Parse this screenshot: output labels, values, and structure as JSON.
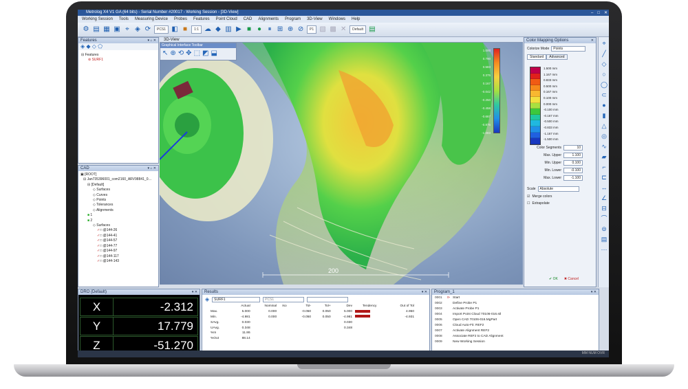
{
  "window": {
    "title": "Metrolog X4 V1 GA (64 bits) - Serial Number #20017 - Working Session - [3D-View]"
  },
  "menu": [
    "Working Session",
    "Tools",
    "Measuring Device",
    "Probes",
    "Features",
    "Point Cloud",
    "CAD",
    "Alignments",
    "Program",
    "3D-View",
    "Windows",
    "Help"
  ],
  "toolbar": {
    "frame": "PCS1",
    "zoom": "1:1",
    "probe": "P1",
    "view": "Default"
  },
  "features_panel": {
    "title": "Features",
    "items": [
      "Features",
      "SURF1"
    ]
  },
  "cad_panel": {
    "title": "CAD",
    "items": [
      "[ROOT]",
      "Jan735396001_com2160_ARV98841_0…",
      "[Default]",
      "Surfaces",
      "Curves",
      "Points",
      "Tolerances",
      "Alignments",
      "1",
      "2",
      "Surfaces",
      "@144-26",
      "@144-41",
      "@144-57",
      "@144-77",
      "@144-97",
      "@144-117",
      "@144-143"
    ]
  },
  "viewport": {
    "tab": "3D-View",
    "subtoolbar_title": "Graphical Interface Toolbar",
    "scale_value": "200",
    "colorbar_labels": [
      "1.000",
      "0.790",
      "0.583",
      "0.375",
      "0.167",
      "-0.042",
      "-0.250",
      "-0.458",
      "-0.667",
      "-0.875",
      "-1.083"
    ]
  },
  "color_mapping": {
    "title": "Color Mapping Options",
    "colorize_mode_label": "Colorize Mode",
    "colorize_mode": "Points",
    "tabs": [
      "Standard",
      "Advanced"
    ],
    "scale_values": [
      "1.500 mm",
      "1.167 mm",
      "0.833 mm",
      "0.500 mm",
      "0.167 mm",
      "0.100 mm",
      "0.000 mm",
      "-0.100 mm",
      "-0.167 mm",
      "-0.500 mm",
      "-0.833 mm",
      "-1.167 mm",
      "-1.500 mm"
    ],
    "scale_colors": [
      "#c0004a",
      "#e0201c",
      "#f05a14",
      "#f68a1c",
      "#f8b830",
      "#f2e040",
      "#a8e040",
      "#3cc83c",
      "#20c8a0",
      "#20b8e0",
      "#2090e8",
      "#2060e0",
      "#1838c0"
    ],
    "color_segments_label": "Color Segments",
    "color_segments": "10",
    "max_upper_label": "Max. Upper",
    "max_upper": "1.100",
    "min_upper_label": "Min. Upper",
    "min_upper": "0.100",
    "min_lower_label": "Min. Lower",
    "min_lower": "-0.100",
    "max_lower_label": "Max. Lower",
    "max_lower": "-1.100",
    "scale_label": "Scale",
    "scale": "Absolute",
    "merge_colors": "Merge colors",
    "extrapolate": "Extrapolate",
    "ok": "OK",
    "cancel": "Cancel"
  },
  "dro": {
    "title": "DRO (Default)",
    "x_label": "X",
    "x": "-2.312",
    "y_label": "Y",
    "y": "17.779",
    "z_label": "Z",
    "z": "-51.270"
  },
  "results": {
    "title": "Results",
    "feature": "SURF1",
    "frame": "PCS1",
    "headers": [
      "",
      "Actual",
      "Nominal",
      "Iso",
      "Tol-",
      "Tol+",
      "Dev",
      "Tendency",
      "Out of Tol"
    ],
    "rows": [
      [
        "Max.",
        "5.000",
        "0.000",
        "",
        "-0.050",
        "0.050",
        "5.000",
        "",
        "4.950"
      ],
      [
        "Min.",
        "-4.981",
        "0.000",
        "",
        "-0.050",
        "0.050",
        "-4.981",
        "",
        "-4.931"
      ],
      [
        "SAvg.",
        "0.030",
        "",
        "",
        "",
        "",
        "0.030",
        "",
        ""
      ],
      [
        "UAvg.",
        "0.348",
        "",
        "",
        "",
        "",
        "0.348",
        "",
        ""
      ],
      [
        "%In",
        "11.86",
        "",
        "",
        "",
        "",
        "",
        "",
        ""
      ],
      [
        "%Out",
        "88.14",
        "",
        "",
        "",
        "",
        "",
        "",
        ""
      ]
    ]
  },
  "program": {
    "title": "Program_1",
    "steps": [
      {
        "n": "0001",
        "label": "Start"
      },
      {
        "n": "0002",
        "label": "Define Probe P1"
      },
      {
        "n": "0003",
        "label": "Activate Probe P1"
      },
      {
        "n": "0004",
        "label": "Import Point Cloud 70106-016.stl"
      },
      {
        "n": "0005",
        "label": "Open CAD 70106-016.MgPart"
      },
      {
        "n": "0006",
        "label": "Cloud Auto-Fit: REF2"
      },
      {
        "n": "0007",
        "label": "Activate Alignment REF2"
      },
      {
        "n": "0008",
        "label": "Associate REF2 to CAD Alignment"
      },
      {
        "n": "0009",
        "label": "New Working Session"
      }
    ]
  },
  "status": {
    "text": "MM NUM OVR"
  }
}
